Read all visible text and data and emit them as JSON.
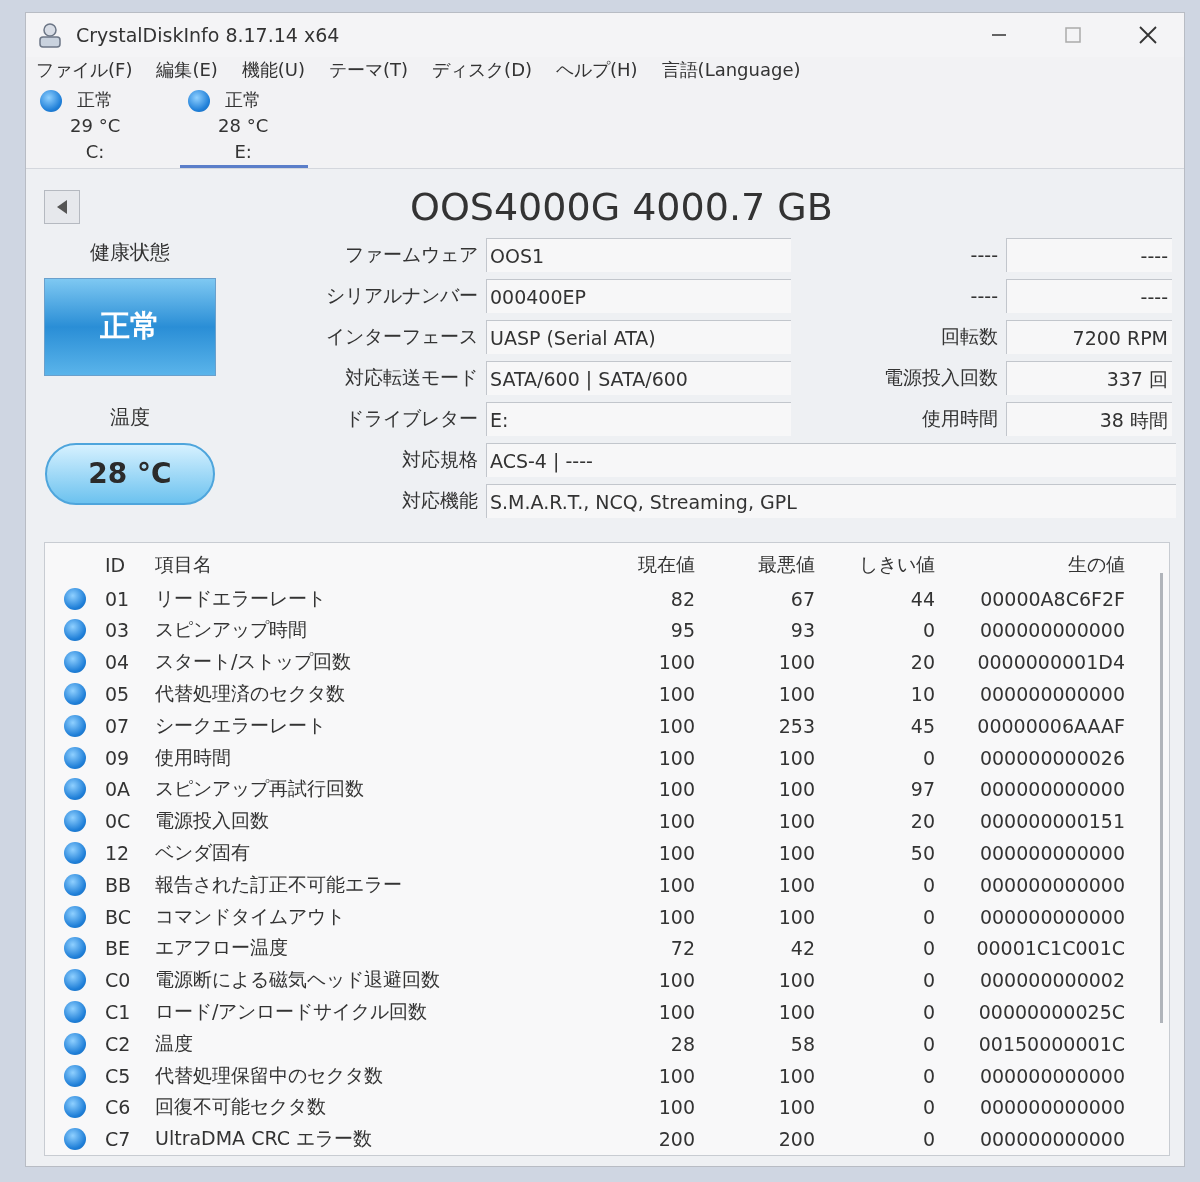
{
  "window": {
    "title": "CrystalDiskInfo 8.17.14 x64"
  },
  "menu": [
    "ファイル(F)",
    "編集(E)",
    "機能(U)",
    "テーマ(T)",
    "ディスク(D)",
    "ヘルプ(H)",
    "言語(Language)"
  ],
  "disks": [
    {
      "status": "正常",
      "temperature": "29 °C",
      "letter": "C:",
      "selected": false
    },
    {
      "status": "正常",
      "temperature": "28 °C",
      "letter": "E:",
      "selected": true
    }
  ],
  "model": "OOS4000G 4000.7 GB",
  "health": {
    "label": "健康状態",
    "status": "正常"
  },
  "temperature": {
    "label": "温度",
    "value": "28 °C"
  },
  "info_rows": [
    {
      "label": "ファームウェア",
      "value": "OOS1",
      "side_label": "----",
      "side_value": "----"
    },
    {
      "label": "シリアルナンバー",
      "value": "000400EP",
      "side_label": "----",
      "side_value": "----"
    },
    {
      "label": "インターフェース",
      "value": "UASP (Serial ATA)",
      "side_label": "回転数",
      "side_value": "7200 RPM"
    },
    {
      "label": "対応転送モード",
      "value": "SATA/600 | SATA/600",
      "side_label": "電源投入回数",
      "side_value": "337 回"
    },
    {
      "label": "ドライブレター",
      "value": "E:",
      "side_label": "使用時間",
      "side_value": "38 時間"
    }
  ],
  "wide_rows": [
    {
      "label": "対応規格",
      "value": "ACS-4 | ----"
    },
    {
      "label": "対応機能",
      "value": "S.M.A.R.T., NCQ, Streaming, GPL"
    }
  ],
  "table": {
    "columns": [
      "ID",
      "項目名",
      "現在値",
      "最悪値",
      "しきい値",
      "生の値"
    ],
    "rows": [
      {
        "id": "01",
        "name": "リードエラーレート",
        "current": "82",
        "worst": "67",
        "threshold": "44",
        "raw": "00000A8C6F2F"
      },
      {
        "id": "03",
        "name": "スピンアップ時間",
        "current": "95",
        "worst": "93",
        "threshold": "0",
        "raw": "000000000000"
      },
      {
        "id": "04",
        "name": "スタート/ストップ回数",
        "current": "100",
        "worst": "100",
        "threshold": "20",
        "raw": "0000000001D4"
      },
      {
        "id": "05",
        "name": "代替処理済のセクタ数",
        "current": "100",
        "worst": "100",
        "threshold": "10",
        "raw": "000000000000"
      },
      {
        "id": "07",
        "name": "シークエラーレート",
        "current": "100",
        "worst": "253",
        "threshold": "45",
        "raw": "00000006AAAF"
      },
      {
        "id": "09",
        "name": "使用時間",
        "current": "100",
        "worst": "100",
        "threshold": "0",
        "raw": "000000000026"
      },
      {
        "id": "0A",
        "name": "スピンアップ再試行回数",
        "current": "100",
        "worst": "100",
        "threshold": "97",
        "raw": "000000000000"
      },
      {
        "id": "0C",
        "name": "電源投入回数",
        "current": "100",
        "worst": "100",
        "threshold": "20",
        "raw": "000000000151"
      },
      {
        "id": "12",
        "name": "ベンダ固有",
        "current": "100",
        "worst": "100",
        "threshold": "50",
        "raw": "000000000000"
      },
      {
        "id": "BB",
        "name": "報告された訂正不可能エラー",
        "current": "100",
        "worst": "100",
        "threshold": "0",
        "raw": "000000000000"
      },
      {
        "id": "BC",
        "name": "コマンドタイムアウト",
        "current": "100",
        "worst": "100",
        "threshold": "0",
        "raw": "000000000000"
      },
      {
        "id": "BE",
        "name": "エアフロー温度",
        "current": "72",
        "worst": "42",
        "threshold": "0",
        "raw": "00001C1C001C"
      },
      {
        "id": "C0",
        "name": "電源断による磁気ヘッド退避回数",
        "current": "100",
        "worst": "100",
        "threshold": "0",
        "raw": "000000000002"
      },
      {
        "id": "C1",
        "name": "ロード/アンロードサイクル回数",
        "current": "100",
        "worst": "100",
        "threshold": "0",
        "raw": "00000000025C"
      },
      {
        "id": "C2",
        "name": "温度",
        "current": "28",
        "worst": "58",
        "threshold": "0",
        "raw": "00150000001C"
      },
      {
        "id": "C5",
        "name": "代替処理保留中のセクタ数",
        "current": "100",
        "worst": "100",
        "threshold": "0",
        "raw": "000000000000"
      },
      {
        "id": "C6",
        "name": "回復不可能セクタ数",
        "current": "100",
        "worst": "100",
        "threshold": "0",
        "raw": "000000000000"
      },
      {
        "id": "C7",
        "name": "UltraDMA CRC エラー数",
        "current": "200",
        "worst": "200",
        "threshold": "0",
        "raw": "000000000000"
      }
    ]
  }
}
